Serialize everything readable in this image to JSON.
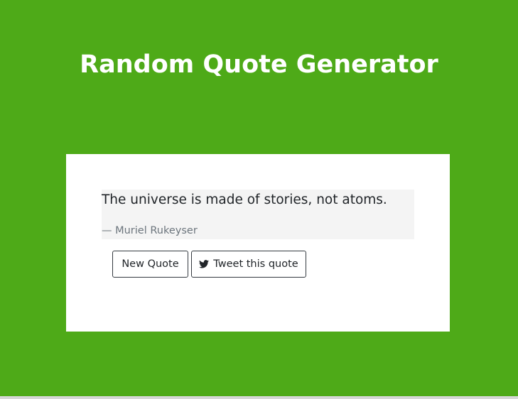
{
  "header": {
    "title": "Random Quote Generator"
  },
  "quote": {
    "text": "The universe is made of stories, not atoms.",
    "author": "— Muriel Rukeyser"
  },
  "buttons": {
    "new_quote_label": "New Quote",
    "tweet_label": "Tweet this quote",
    "tweet_icon": "twitter-bird-icon"
  },
  "colors": {
    "background": "#4eaa18",
    "card": "#ffffff",
    "quote_block": "#f4f4f4"
  }
}
